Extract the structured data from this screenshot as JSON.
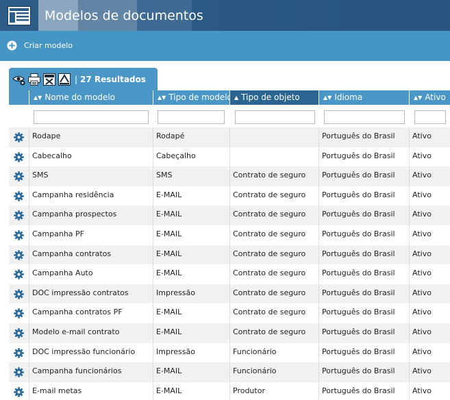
{
  "app": {
    "title": "Modelos de documentos",
    "icon": "document-list-icon"
  },
  "actions": {
    "create_label": "Criar modelo",
    "create_icon": "plus-circle-icon"
  },
  "toolbar": {
    "icons": [
      "visibility-settings-icon",
      "print-icon",
      "export-excel-icon",
      "export-xml-icon"
    ],
    "separator": "|",
    "results": "27 Resultados"
  },
  "grid": {
    "columns": [
      {
        "key": "nome",
        "label": "Nome do modelo",
        "sort": "none"
      },
      {
        "key": "tipo_modelo",
        "label": "Tipo de modelo",
        "sort": "none"
      },
      {
        "key": "tipo_objeto",
        "label": "Tipo de objeto",
        "sort": "asc"
      },
      {
        "key": "idioma",
        "label": "Idioma",
        "sort": "none"
      },
      {
        "key": "ativo",
        "label": "Ativo",
        "sort": "none"
      }
    ],
    "row_icon": "gear-icon",
    "rows": [
      {
        "nome": "Rodape",
        "tipo_modelo": "Rodapé",
        "tipo_objeto": "",
        "idioma": "Português do Brasil",
        "ativo": "Ativo"
      },
      {
        "nome": "Cabecalho",
        "tipo_modelo": "Cabeçalho",
        "tipo_objeto": "",
        "idioma": "Português do Brasil",
        "ativo": "Ativo"
      },
      {
        "nome": "SMS",
        "tipo_modelo": "SMS",
        "tipo_objeto": "Contrato de seguro",
        "idioma": "Português do Brasil",
        "ativo": "Ativo"
      },
      {
        "nome": "Campanha residência",
        "tipo_modelo": "E-MAIL",
        "tipo_objeto": "Contrato de seguro",
        "idioma": "Português do Brasil",
        "ativo": "Ativo"
      },
      {
        "nome": "Campanha prospectos",
        "tipo_modelo": "E-MAIL",
        "tipo_objeto": "Contrato de seguro",
        "idioma": "Português do Brasil",
        "ativo": "Ativo"
      },
      {
        "nome": "Campanha PF",
        "tipo_modelo": "E-MAIL",
        "tipo_objeto": "Contrato de seguro",
        "idioma": "Português do Brasil",
        "ativo": "Ativo"
      },
      {
        "nome": "Campanha contratos",
        "tipo_modelo": "E-MAIL",
        "tipo_objeto": "Contrato de seguro",
        "idioma": "Português do Brasil",
        "ativo": "Ativo"
      },
      {
        "nome": "Campanha Auto",
        "tipo_modelo": "E-MAIL",
        "tipo_objeto": "Contrato de seguro",
        "idioma": "Português do Brasil",
        "ativo": "Ativo"
      },
      {
        "nome": "DOC impressão contratos",
        "tipo_modelo": "Impressão",
        "tipo_objeto": "Contrato de seguro",
        "idioma": "Português do Brasil",
        "ativo": "Ativo"
      },
      {
        "nome": "Campanha contratos PF",
        "tipo_modelo": "E-MAIL",
        "tipo_objeto": "Contrato de seguro",
        "idioma": "Português do Brasil",
        "ativo": "Ativo"
      },
      {
        "nome": "Modelo e-mail contrato",
        "tipo_modelo": "E-MAIL",
        "tipo_objeto": "Contrato de seguro",
        "idioma": "Português do Brasil",
        "ativo": "Ativo"
      },
      {
        "nome": "DOC impressão funcionário",
        "tipo_modelo": "Impressão",
        "tipo_objeto": "Funcionário",
        "idioma": "Português do Brasil",
        "ativo": "Ativo"
      },
      {
        "nome": "Campanha funcionários",
        "tipo_modelo": "E-MAIL",
        "tipo_objeto": "Funcionário",
        "idioma": "Português do Brasil",
        "ativo": "Ativo"
      },
      {
        "nome": "E-mail metas",
        "tipo_modelo": "E-MAIL",
        "tipo_objeto": "Produtor",
        "idioma": "Português do Brasil",
        "ativo": "Ativo"
      }
    ]
  },
  "colors": {
    "titlebar": "#2d5c86",
    "actionbar": "#4595c5",
    "header": "#4a97c7",
    "sorted_header": "#2b6591",
    "gear": "#2a6a9e"
  }
}
